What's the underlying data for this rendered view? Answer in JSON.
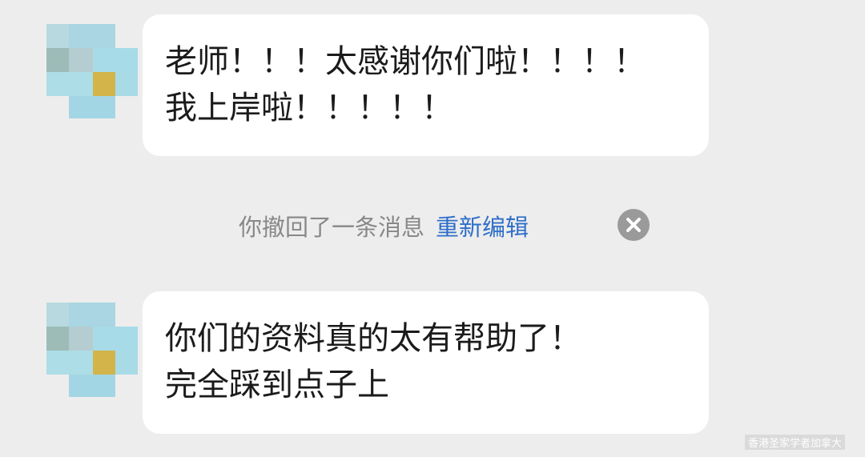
{
  "colors": {
    "background": "#ededed",
    "bubble": "#ffffff",
    "text": "#1b1b1b",
    "system_text": "#888888",
    "link": "#2f6fc9"
  },
  "messages": [
    {
      "sender": "contact",
      "lines": [
        "老师！！！太感谢你们啦！！！！",
        "我上岸啦！！！！！"
      ]
    },
    {
      "sender": "contact",
      "lines": [
        "你们的资料真的太有帮助了！",
        "完全踩到点子上"
      ]
    }
  ],
  "system_notice": {
    "text": "你撤回了一条消息",
    "action_label": "重新编辑",
    "dismiss_icon": "close-circle-icon"
  },
  "watermark": {
    "text": "香港圣家学者加拿大"
  }
}
